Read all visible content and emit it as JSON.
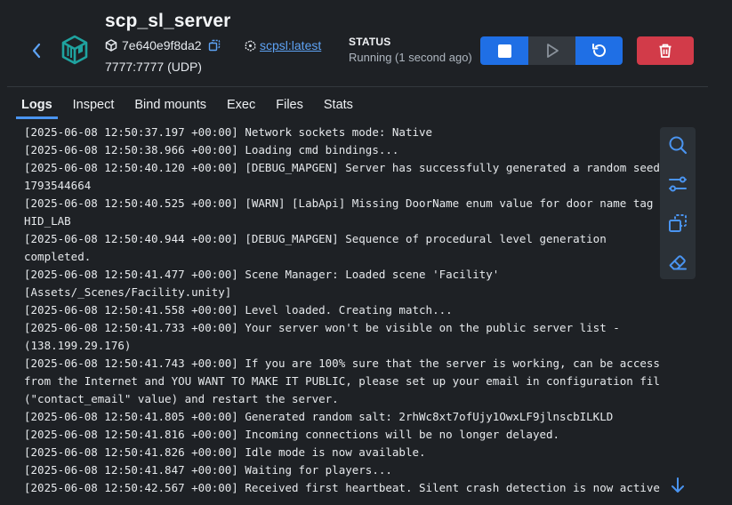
{
  "container": {
    "name": "scp_sl_server",
    "id": "7e640e9f8da2",
    "ports": "7777:7777 (UDP)",
    "image": "scpsl:latest",
    "status_label": "STATUS",
    "status_value": "Running (1 second ago)"
  },
  "colors": {
    "accent": "#1f6fe5",
    "link": "#5ea3f5",
    "danger": "#d23b49",
    "brand_teal": "#1fa3a0"
  },
  "icons": {
    "back": "chevron-left-icon",
    "container": "container-box-icon",
    "id": "cube-icon",
    "copy": "copy-icon",
    "image": "image-layers-icon",
    "stop": "stop-icon",
    "start": "play-icon",
    "restart": "restart-icon",
    "delete": "trash-icon",
    "search": "search-icon",
    "filter": "sliders-icon",
    "copy_logs": "copy-icon",
    "clear": "eraser-icon",
    "scroll": "arrow-down-icon"
  },
  "tabs": [
    {
      "label": "Logs",
      "active": true
    },
    {
      "label": "Inspect"
    },
    {
      "label": "Bind mounts"
    },
    {
      "label": "Exec"
    },
    {
      "label": "Files"
    },
    {
      "label": "Stats"
    }
  ],
  "logs": [
    "[2025-06-08 12:50:37.197 +00:00] Network sockets mode: Native",
    "[2025-06-08 12:50:38.966 +00:00] Loading cmd bindings...",
    "[2025-06-08 12:50:40.120 +00:00] [DEBUG_MAPGEN] Server has successfully generated a random seed:",
    "1793544664",
    "[2025-06-08 12:50:40.525 +00:00] [WARN] [LabApi] Missing DoorName enum value for door name tag",
    "HID_LAB",
    "[2025-06-08 12:50:40.944 +00:00] [DEBUG_MAPGEN] Sequence of procedural level generation",
    "completed.",
    "[2025-06-08 12:50:41.477 +00:00] Scene Manager: Loaded scene 'Facility'",
    "[Assets/_Scenes/Facility.unity]",
    "[2025-06-08 12:50:41.558 +00:00] Level loaded. Creating match...",
    "[2025-06-08 12:50:41.733 +00:00] Your server won't be visible on the public server list -",
    "(138.199.29.176)",
    "[2025-06-08 12:50:41.743 +00:00] If you are 100% sure that the server is working, can be accessed",
    "from the Internet and YOU WANT TO MAKE IT PUBLIC, please set up your email in configuration file",
    "(\"contact_email\" value) and restart the server.",
    "[2025-06-08 12:50:41.805 +00:00] Generated random salt: 2rhWc8xt7ofUjy1OwxLF9jlnscbILKLD",
    "[2025-06-08 12:50:41.816 +00:00] Incoming connections will be no longer delayed.",
    "[2025-06-08 12:50:41.826 +00:00] Idle mode is now available.",
    "[2025-06-08 12:50:41.847 +00:00] Waiting for players...",
    "[2025-06-08 12:50:42.567 +00:00] Received first heartbeat. Silent crash detection is now active."
  ]
}
